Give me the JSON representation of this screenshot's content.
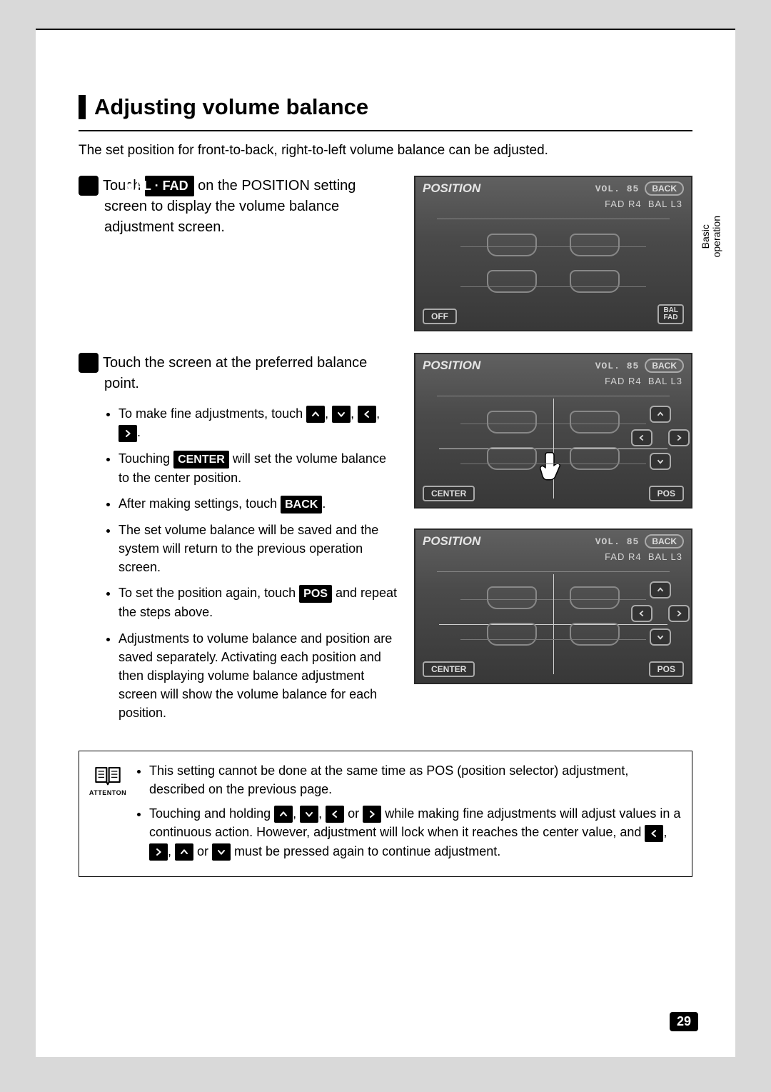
{
  "sideTab": {
    "line1": "Basic",
    "line2": "operation"
  },
  "section": {
    "title": "Adjusting volume balance",
    "intro": "The set position for front-to-back, right-to-left volume balance can be adjusted."
  },
  "steps": {
    "s1": {
      "num": "1",
      "lead_a": "Touch ",
      "pill": "BAL · FAD",
      "lead_b": " on the POSITION setting screen to display the volume balance adjustment screen."
    },
    "s2": {
      "num": "2",
      "lead": "Touch the screen at the preferred balance point.",
      "b1a": "To make fine adjustments, touch ",
      "b1b": ", ",
      "b1c": ", ",
      "b1d": ", ",
      "b1e": ".",
      "b2a": "Touching ",
      "b2pill": "CENTER",
      "b2b": " will set the volume balance to the center position.",
      "b3a": "After making settings, touch ",
      "b3pill": "BACK",
      "b3b": ".",
      "b4": "The set volume balance will be saved and the system will return to the previous operation screen.",
      "b5a": "To set the position again, touch ",
      "b5pill": "POS",
      "b5b": " and repeat the steps above.",
      "b6": "Adjustments to volume balance and position are saved separately. Activating each position and then displaying volume balance adjustment screen will show the volume balance for each position."
    }
  },
  "shot": {
    "title": "POSITION",
    "vol_label": "VOL.",
    "vol_value": "85",
    "back": "BACK",
    "fad": "FAD R4",
    "bal": "BAL L3",
    "off": "OFF",
    "balfad": "BAL\nFAD",
    "center": "CENTER",
    "pos": "POS"
  },
  "attention": {
    "label": "ATTENTON",
    "n1": "This setting cannot be done at the same time as POS (position selector) adjustment, described on the previous page.",
    "n2a": "Touching and holding ",
    "n2b": ", ",
    "n2c": ", ",
    "n2d": " or ",
    "n2e": " while making fine adjustments will adjust values in a continuous action.  However, adjustment will lock when it reaches the center value, and ",
    "n2f": ", ",
    "n2g": ", ",
    "n2h": " or ",
    "n2i": " must be pressed again to continue adjustment."
  },
  "pageNumber": "29"
}
